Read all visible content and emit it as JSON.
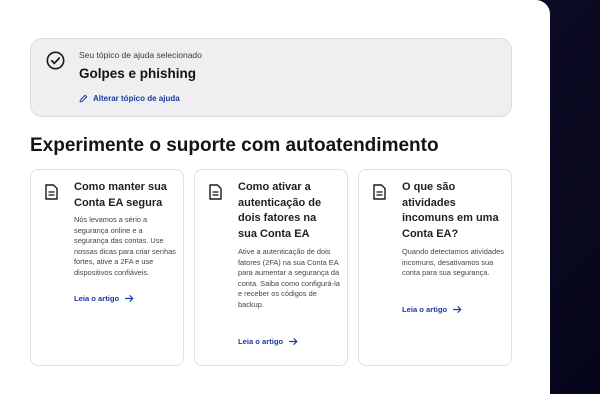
{
  "topic": {
    "label": "Seu tópico de ajuda selecionado",
    "title": "Golpes e phishing",
    "change_link": "Alterar tópico de ajuda"
  },
  "section_title": "Experimente o suporte com autoatendimento",
  "cards": [
    {
      "title": "Como manter sua Conta EA segura",
      "description": "Nós levamos a sério a segurança online e a segurança das contas. Use nossas dicas para criar senhas fortes, ative a 2FA e use dispositivos confiáveis.",
      "link": "Leia o artigo"
    },
    {
      "title": "Como ativar a autenticação de dois fatores na sua Conta EA",
      "description": "Ative a autenticação de dois fatores (2FA) na sua Conta EA para aumentar a segurança da conta. Saiba como configurá-la e receber os códigos de backup.",
      "link": "Leia o artigo"
    },
    {
      "title": "O que são atividades incomuns em uma Conta EA?",
      "description": "Quando detectamos atividades incomuns, desativamos sua conta para sua segurança.",
      "link": "Leia o artigo"
    }
  ],
  "icons": {
    "check": "check-circle-icon",
    "edit": "pencil-icon",
    "document": "document-icon",
    "arrow": "arrow-right-icon"
  },
  "colors": {
    "link": "#1a3a9e",
    "panel": "#ffffff",
    "topic_card_bg": "#efeff1",
    "background": "#0c0b24"
  }
}
